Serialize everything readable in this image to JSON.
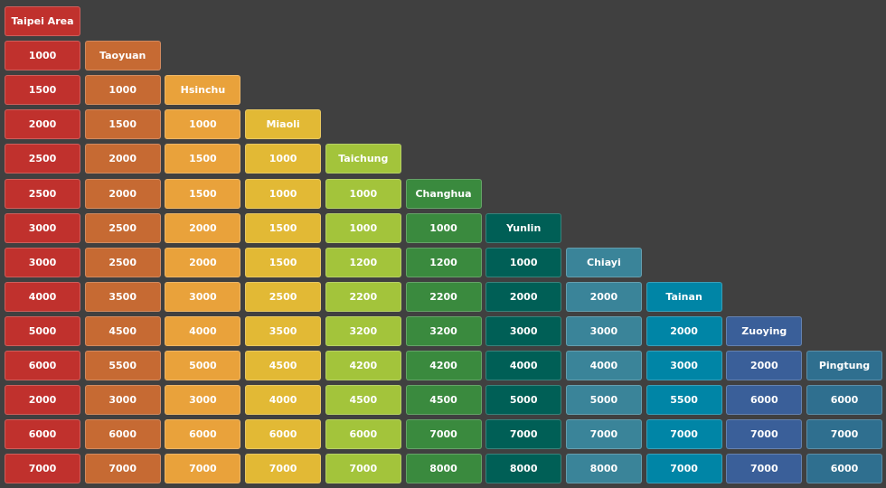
{
  "columns": [
    {
      "station": "Taipei Area",
      "color": "#c0312d"
    },
    {
      "station": "Taoyuan",
      "color": "#c66a33"
    },
    {
      "station": "Hsinchu",
      "color": "#e9a23b"
    },
    {
      "station": "Miaoli",
      "color": "#e2b935"
    },
    {
      "station": "Taichung",
      "color": "#a3c43b"
    },
    {
      "station": "Changhua",
      "color": "#3a8a3e"
    },
    {
      "station": "Yunlin",
      "color": "#005f56"
    },
    {
      "station": "Chiayi",
      "color": "#3a8499"
    },
    {
      "station": "Tainan",
      "color": "#0085a6"
    },
    {
      "station": "Zuoying",
      "color": "#3a5f99"
    },
    {
      "station": "Pingtung",
      "color": "#2f6f8f"
    }
  ],
  "rows": [
    [
      "1000"
    ],
    [
      "1500",
      "1000"
    ],
    [
      "2000",
      "1500",
      "1000"
    ],
    [
      "2500",
      "2000",
      "1500",
      "1000"
    ],
    [
      "2500",
      "2000",
      "1500",
      "1000",
      "1000"
    ],
    [
      "3000",
      "2500",
      "2000",
      "1500",
      "1000",
      "1000"
    ],
    [
      "3000",
      "2500",
      "2000",
      "1500",
      "1200",
      "1200",
      "1000"
    ],
    [
      "4000",
      "3500",
      "3000",
      "2500",
      "2200",
      "2200",
      "2000",
      "2000"
    ],
    [
      "5000",
      "4500",
      "4000",
      "3500",
      "3200",
      "3200",
      "3000",
      "3000",
      "2000"
    ],
    [
      "6000",
      "5500",
      "5000",
      "4500",
      "4200",
      "4200",
      "4000",
      "4000",
      "3000",
      "2000"
    ],
    [
      "2000",
      "3000",
      "3000",
      "4000",
      "4500",
      "4500",
      "5000",
      "5000",
      "5500",
      "6000",
      "6000"
    ],
    [
      "6000",
      "6000",
      "6000",
      "6000",
      "6000",
      "7000",
      "7000",
      "7000",
      "7000",
      "7000",
      "7000"
    ],
    [
      "7000",
      "7000",
      "7000",
      "7000",
      "7000",
      "8000",
      "8000",
      "8000",
      "7000",
      "7000",
      "6000"
    ]
  ]
}
